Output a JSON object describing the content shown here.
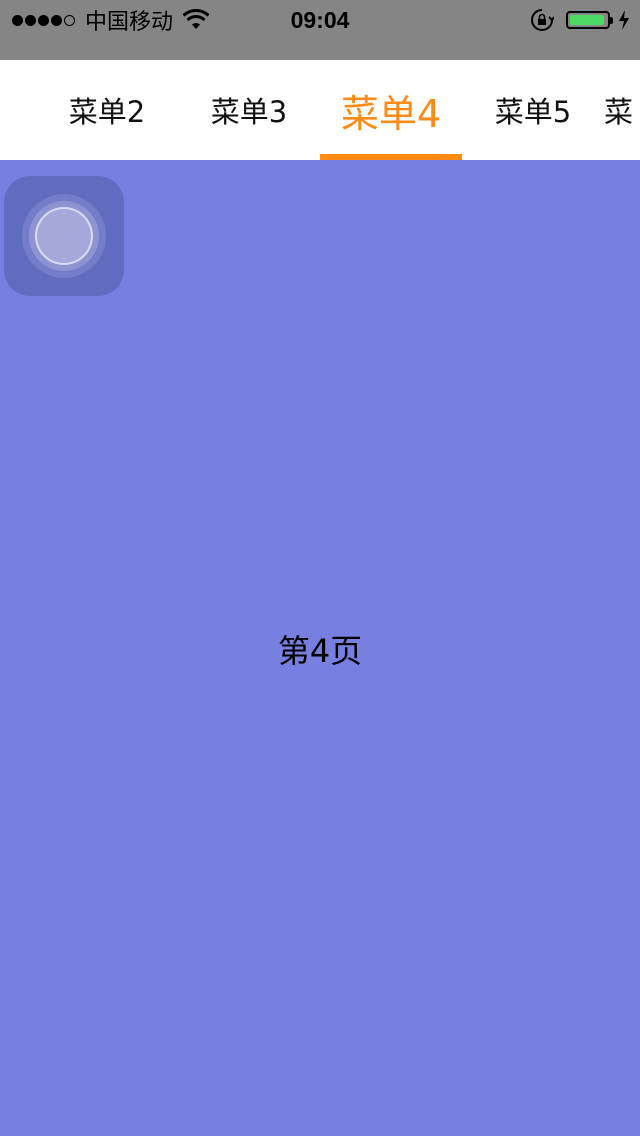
{
  "status_bar": {
    "carrier": "中国移动",
    "time": "09:04",
    "battery_level": 0.95,
    "battery_color": "#4cd964"
  },
  "menu": {
    "tabs": [
      {
        "label": "菜单2",
        "active": false
      },
      {
        "label": "菜单3",
        "active": false
      },
      {
        "label": "菜单4",
        "active": true
      },
      {
        "label": "菜单5",
        "active": false
      },
      {
        "label": "菜",
        "active": false
      }
    ],
    "active_color": "#ff8a14"
  },
  "page": {
    "label": "第4页",
    "background": "#7780e1"
  },
  "icons": [
    "wifi-icon",
    "rotation-lock-icon",
    "battery-icon",
    "charging-icon",
    "assistive-touch-icon"
  ]
}
